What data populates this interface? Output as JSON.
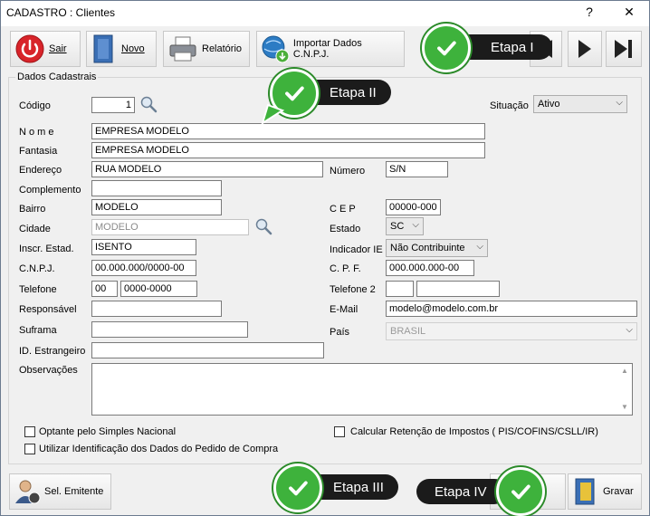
{
  "window": {
    "title": "CADASTRO : Clientes",
    "help_label": "?",
    "close_label": "✕"
  },
  "toolbar": {
    "sair": "Sair",
    "novo": "Novo",
    "relatorio": "Relatório",
    "importar": "Importar Dados C.N.P.J."
  },
  "group": {
    "title": "Dados Cadastrais"
  },
  "form": {
    "codigo_label": "Código",
    "codigo_value": "1",
    "situacao_label": "Situação",
    "situacao_value": "Ativo",
    "nome_label": "N o m e",
    "nome_value": "EMPRESA MODELO",
    "fantasia_label": "Fantasia",
    "fantasia_value": "EMPRESA MODELO",
    "endereco_label": "Endereço",
    "endereco_value": "RUA MODELO",
    "numero_label": "Número",
    "numero_value": "S/N",
    "complemento_label": "Complemento",
    "complemento_value": "",
    "bairro_label": "Bairro",
    "bairro_value": "MODELO",
    "cep_label": "C E P",
    "cep_value": "00000-000",
    "cidade_label": "Cidade",
    "cidade_value": "MODELO",
    "estado_label": "Estado",
    "estado_value": "SC",
    "inscr_label": "Inscr. Estad.",
    "inscr_value": "ISENTO",
    "indicador_label": "Indicador IE",
    "indicador_value": "Não Contribuinte",
    "cnpj_label": "C.N.P.J.",
    "cnpj_value": "00.000.000/0000-00",
    "cpf_label": "C. P. F.",
    "cpf_value": "000.000.000-00",
    "telefone_label": "Telefone",
    "telefone_ddd": "00",
    "telefone_value": "0000-0000",
    "telefone2_label": "Telefone 2",
    "telefone2_ddd": "",
    "telefone2_value": "",
    "responsavel_label": "Responsável",
    "responsavel_value": "",
    "email_label": "E-Mail",
    "email_value": "modelo@modelo.com.br",
    "suframa_label": "Suframa",
    "suframa_value": "",
    "pais_label": "País",
    "pais_value": "BRASIL",
    "id_estrangeiro_label": "ID. Estrangeiro",
    "id_estrangeiro_value": "",
    "observacoes_label": "Observações",
    "observacoes_value": ""
  },
  "checks": {
    "simples": "Optante pelo Simples Nacional",
    "retencao": "Calcular Retenção de Impostos ( PIS/COFINS/CSLL/IR)",
    "identificacao": "Utilizar Identificação dos Dados do Pedido de Compra"
  },
  "bottom": {
    "emitente": "Sel. Emitente",
    "gravar": "Gravar"
  },
  "annotations": {
    "etapa1": "Etapa I",
    "etapa2": "Etapa II",
    "etapa3": "Etapa III",
    "etapa4": "Etapa IV"
  },
  "colors": {
    "badge_green": "#3eb23c",
    "badge_dark": "#1b1b1b",
    "window_bg": "#f0f0f0"
  }
}
